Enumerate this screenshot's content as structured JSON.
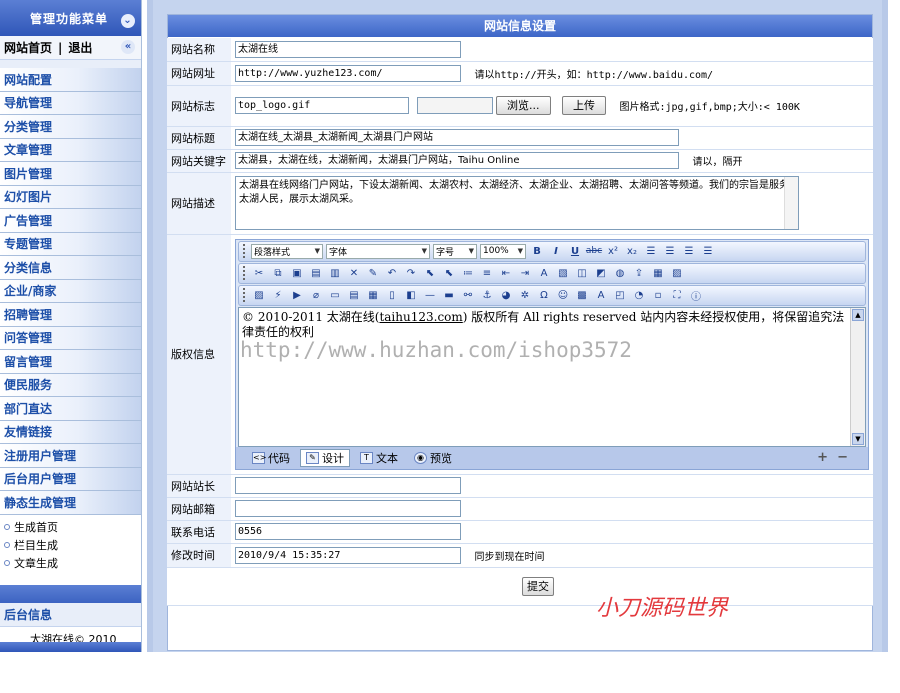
{
  "sidebar": {
    "header": "管理功能菜单",
    "home": "网站首页",
    "separator": "|",
    "logout": "退出",
    "items": [
      {
        "label": "网站配置"
      },
      {
        "label": "导航管理"
      },
      {
        "label": "分类管理"
      },
      {
        "label": "文章管理"
      },
      {
        "label": "图片管理"
      },
      {
        "label": "幻灯图片"
      },
      {
        "label": "广告管理"
      },
      {
        "label": "专题管理"
      },
      {
        "label": "分类信息"
      },
      {
        "label": "企业/商家"
      },
      {
        "label": "招聘管理"
      },
      {
        "label": "问答管理"
      },
      {
        "label": "留言管理"
      },
      {
        "label": "便民服务"
      },
      {
        "label": "部门直达"
      },
      {
        "label": "友情链接"
      },
      {
        "label": "注册用户管理"
      },
      {
        "label": "后台用户管理"
      },
      {
        "label": "静态生成管理"
      }
    ],
    "sub_items": [
      {
        "label": "生成首页"
      },
      {
        "label": "栏目生成"
      },
      {
        "label": "文章生成"
      }
    ],
    "info_title": "后台信息",
    "info_text": "太湖在线© 2010"
  },
  "panel": {
    "title": "网站信息设置",
    "fields": {
      "site_name": {
        "label": "网站名称",
        "value": "太湖在线"
      },
      "site_url": {
        "label": "网站网址",
        "value": "http://www.yuzhe123.com/",
        "hint": "请以http://开头，如：http://www.baidu.com/"
      },
      "site_logo": {
        "label": "网站标志",
        "value": "top_logo.gif",
        "browse": "浏览...",
        "upload": "上传",
        "hint": "图片格式:jpg,gif,bmp;大小:< 100K"
      },
      "site_title": {
        "label": "网站标题",
        "value": "太湖在线_太湖县_太湖新闻_太湖县门户网站"
      },
      "site_keywords": {
        "label": "网站关键字",
        "value": "太湖县，太湖在线，太湖新闻，太湖县门户网站，Taihu Online",
        "hint": "请以，隔开"
      },
      "site_desc": {
        "label": "网站描述",
        "value": "太湖县在线网络门户网站，下设太湖新闻、太湖农村、太湖经济、太湖企业、太湖招聘、太湖问答等频道。我们的宗旨是服务太湖人民，展示太湖风采。"
      },
      "copyright": {
        "label": "版权信息"
      },
      "webmaster": {
        "label": "网站站长",
        "value": ""
      },
      "email": {
        "label": "网站邮箱",
        "value": ""
      },
      "phone": {
        "label": "联系电话",
        "value": "0556"
      },
      "modified": {
        "label": "修改时间",
        "value": "2010/9/4 15:35:27",
        "hint": "同步到现在时间"
      }
    },
    "submit": "提交"
  },
  "editor": {
    "style_select": "段落样式",
    "font_select": "字体",
    "size_select": "字号",
    "zoom_select": "100%",
    "content_prefix": "© 2010-2011 太湖在线(",
    "content_link": "taihu123.com",
    "content_suffix": ") 版权所有  All rights reserved  站内内容未经授权使用，将保留追究法律责任的权利",
    "tabs": [
      {
        "label": "代码",
        "icon": "code-icon"
      },
      {
        "label": "设计",
        "icon": "design-icon"
      },
      {
        "label": "文本",
        "icon": "text-icon"
      },
      {
        "label": "预览",
        "icon": "preview-icon"
      }
    ],
    "plus": "+",
    "minus": "−"
  },
  "overlay": {
    "watermark": "http://www.huzhan.com/ishop3572",
    "signature": "小刀源码世界"
  },
  "colors": {
    "accent": "#3d66c7",
    "sidebar_text": "#1d4fa8",
    "signature": "#e3393d"
  }
}
